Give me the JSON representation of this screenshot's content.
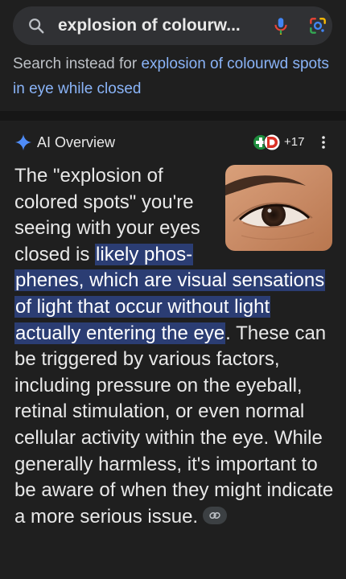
{
  "search": {
    "query": "explosion of colourw..."
  },
  "search_instead": {
    "prefix": "Search instead for ",
    "query_link": "explosion of colourwd spots in eye while closed"
  },
  "ai_overview": {
    "label": "AI Overview",
    "sources_count": "+17",
    "text_before": "The \"explosion of colored spots\" you're seeing with your eyes closed is ",
    "text_highlight": "likely phos­phenes, which are visual sensa­tions of light that occur without light actually entering the eye",
    "text_after": ". These can be triggered by various factors, including pressure on the eyeball, retinal stimulation, or even normal cellular activity within the eye. While generally harmless, it's important to be aware of when they might indicate a more serious issue."
  },
  "colors": {
    "background": "#1f1f1f",
    "link": "#8ab4f8",
    "highlight": "#2b3d73",
    "ai_spark": "#4f8cf7"
  },
  "icons": {
    "search": "magnifier-icon",
    "mic": "microphone-icon",
    "lens": "google-lens-icon",
    "spark": "ai-sparkle-icon",
    "more": "more-vertical-icon",
    "link": "link-icon"
  }
}
